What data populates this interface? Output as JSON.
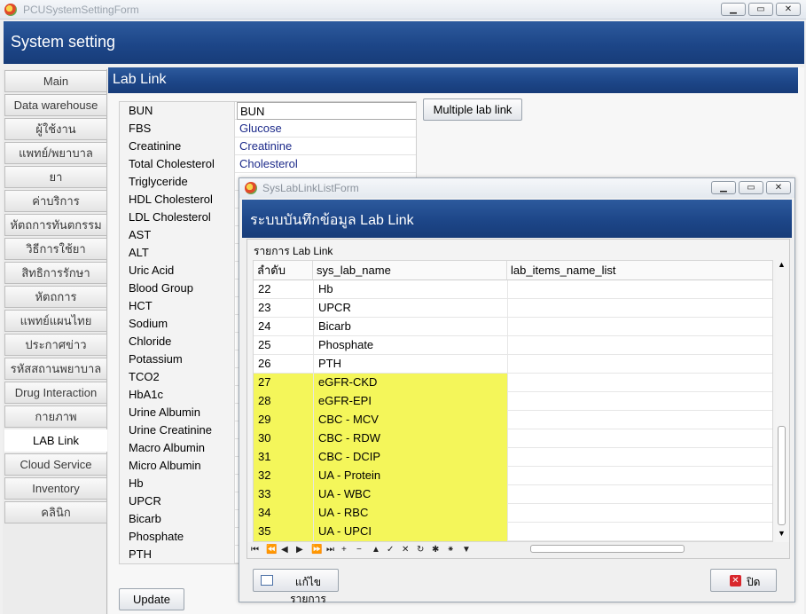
{
  "window": {
    "title": "PCUSystemSettingForm",
    "buttons": [
      "▁",
      "▭",
      "✕"
    ]
  },
  "header": {
    "title": "System setting"
  },
  "nav": {
    "items": [
      "Main",
      "Data warehouse",
      "ผู้ใช้งาน",
      "แพทย์/พยาบาล",
      "ยา",
      "ค่าบริการ",
      "หัตถการทันตกรรม",
      "วิธีการใช้ยา",
      "สิทธิการรักษา",
      "หัตถการ",
      "แพทย์แผนไทย",
      "ประกาศข่าว",
      "รหัสสถานพยาบาล",
      "Drug Interaction",
      "กายภาพ",
      "LAB Link",
      "Cloud Service",
      "Inventory",
      "คลินิก"
    ],
    "active": "LAB Link"
  },
  "lablink": {
    "title": "Lab Link",
    "multiple_button": "Multiple lab link",
    "update_button": "Update",
    "rows": [
      {
        "name": "BUN",
        "value": "BUN"
      },
      {
        "name": "FBS",
        "value": "Glucose"
      },
      {
        "name": "Creatinine",
        "value": "Creatinine"
      },
      {
        "name": "Total Cholesterol",
        "value": "Cholesterol"
      },
      {
        "name": "Triglyceride",
        "value": ""
      },
      {
        "name": "HDL Cholesterol",
        "value": ""
      },
      {
        "name": "LDL Cholesterol",
        "value": ""
      },
      {
        "name": "AST",
        "value": ""
      },
      {
        "name": "ALT",
        "value": ""
      },
      {
        "name": "Uric Acid",
        "value": ""
      },
      {
        "name": "Blood Group",
        "value": ""
      },
      {
        "name": "HCT",
        "value": ""
      },
      {
        "name": "Sodium",
        "value": ""
      },
      {
        "name": "Chloride",
        "value": ""
      },
      {
        "name": "Potassium",
        "value": ""
      },
      {
        "name": "TCO2",
        "value": ""
      },
      {
        "name": "HbA1c",
        "value": ""
      },
      {
        "name": "Urine Albumin",
        "value": ""
      },
      {
        "name": "Urine Creatinine",
        "value": ""
      },
      {
        "name": "Macro Albumin",
        "value": ""
      },
      {
        "name": "Micro Albumin",
        "value": ""
      },
      {
        "name": "Hb",
        "value": ""
      },
      {
        "name": "UPCR",
        "value": ""
      },
      {
        "name": "Bicarb",
        "value": ""
      },
      {
        "name": "Phosphate",
        "value": ""
      },
      {
        "name": "PTH",
        "value": ""
      }
    ]
  },
  "dialog": {
    "title": "SysLabLinkListForm",
    "header": "ระบบบันทึกข้อมูล Lab Link",
    "group_label": "รายการ Lab Link",
    "columns": [
      "ลำดับ",
      "sys_lab_name",
      "lab_items_name_list"
    ],
    "rows": [
      {
        "num": "22",
        "name": "Hb",
        "list": "",
        "hl": false
      },
      {
        "num": "23",
        "name": "UPCR",
        "list": "",
        "hl": false
      },
      {
        "num": "24",
        "name": "Bicarb",
        "list": "",
        "hl": false
      },
      {
        "num": "25",
        "name": "Phosphate",
        "list": "",
        "hl": false
      },
      {
        "num": "26",
        "name": "PTH",
        "list": "",
        "hl": false
      },
      {
        "num": "27",
        "name": "eGFR-CKD",
        "list": "",
        "hl": true
      },
      {
        "num": "28",
        "name": "eGFR-EPI",
        "list": "",
        "hl": true
      },
      {
        "num": "29",
        "name": "CBC - MCV",
        "list": "",
        "hl": true
      },
      {
        "num": "30",
        "name": "CBC - RDW",
        "list": "",
        "hl": true
      },
      {
        "num": "31",
        "name": "CBC - DCIP",
        "list": "",
        "hl": true
      },
      {
        "num": "32",
        "name": "UA - Protein",
        "list": "",
        "hl": true
      },
      {
        "num": "33",
        "name": "UA - WBC",
        "list": "",
        "hl": true
      },
      {
        "num": "34",
        "name": "UA - RBC",
        "list": "",
        "hl": true
      },
      {
        "num": "35",
        "name": "UA - UPCI",
        "list": "",
        "hl": true
      }
    ],
    "navigator": [
      "⏮",
      "⏪",
      "◀",
      "▶",
      "⏩",
      "⏭",
      "+",
      "−",
      "▲",
      "✓",
      "✕",
      "↻",
      "✱",
      "⁕",
      "▼"
    ],
    "edit_button": "แก้ไขรายการ",
    "close_button": "ปิด",
    "colors": {
      "highlight": "#f4f65a",
      "close_icon": "#d9262c"
    }
  }
}
